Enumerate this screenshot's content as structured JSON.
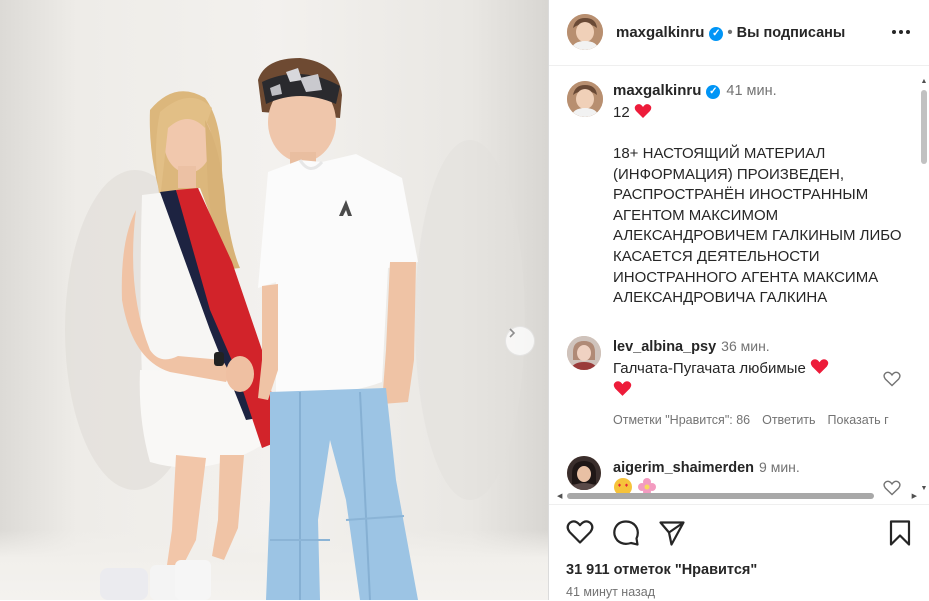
{
  "post": {
    "username": "maxgalkinru",
    "follow_status": "Вы подписаны",
    "verified": true
  },
  "caption": {
    "username": "maxgalkinru",
    "time": "41 мин.",
    "first_line": "12",
    "body": "18+ НАСТОЯЩИЙ МАТЕРИАЛ (ИНФОРМАЦИЯ)  ПРОИЗВЕДЕН, РАСПРОСТРАНЁН ИНОСТРАННЫМ АГЕНТОМ МАКСИМОМ АЛЕКСАНДРОВИЧЕМ ГАЛКИНЫМ ЛИБО КАСАЕТСЯ ДЕЯТЕЛЬНОСТИ ИНОСТРАННОГО АГЕНТА МАКСИМА АЛЕКСАНДРОВИЧА ГАЛКИНА"
  },
  "comments": [
    {
      "username": "lev_albina_psy",
      "time": "36 мин.",
      "text": "Галчата-Пугачата любимые",
      "likes_label": "Отметки \"Нравится\": 86",
      "reply_label": "Ответить",
      "show_label": "Показать г"
    },
    {
      "username": "aigerim_shaimerden",
      "time": "9 мин."
    }
  ],
  "stats": {
    "likes": "31 911 отметок \"Нравится\"",
    "posted": "41 минут назад"
  },
  "icons": {
    "verified": "verified-badge-icon",
    "more": "more-horizontal-icon",
    "heart": "heart-outline-icon",
    "comment": "comment-bubble-icon",
    "share": "paper-plane-icon",
    "save": "bookmark-icon",
    "next": "chevron-right-icon"
  },
  "colors": {
    "verified_blue": "#0095f6",
    "text": "#262626",
    "secondary_text": "#737373",
    "heart_red": "#ed1c3a"
  }
}
